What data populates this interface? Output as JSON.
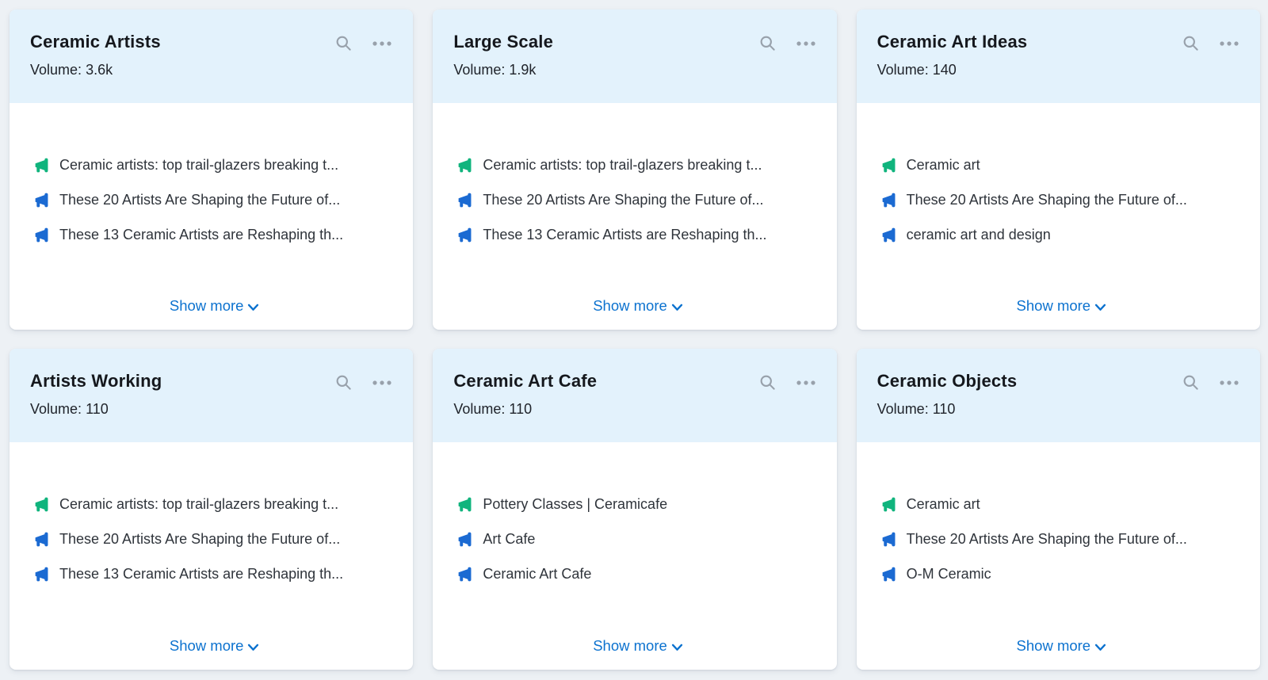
{
  "colors": {
    "page_background": "#edf1f5",
    "card_header_background": "#e3f2fc",
    "megaphone_green": "#10b47d",
    "megaphone_blue": "#1b6ad2",
    "link_blue": "#0c72cf",
    "header_icon_gray": "#98a1ab"
  },
  "card_common": {
    "volume_label": "Volume:",
    "show_more_label": "Show more"
  },
  "cards": [
    {
      "title": "Ceramic Artists",
      "volume_value": "3.6k",
      "items": [
        {
          "text": "Ceramic artists: top trail-glazers breaking t...",
          "icon_color": "green"
        },
        {
          "text": "These 20 Artists Are Shaping the Future of...",
          "icon_color": "blue"
        },
        {
          "text": "These 13 Ceramic Artists are Reshaping th...",
          "icon_color": "blue"
        }
      ]
    },
    {
      "title": "Large Scale",
      "volume_value": "1.9k",
      "items": [
        {
          "text": "Ceramic artists: top trail-glazers breaking t...",
          "icon_color": "green"
        },
        {
          "text": "These 20 Artists Are Shaping the Future of...",
          "icon_color": "blue"
        },
        {
          "text": "These 13 Ceramic Artists are Reshaping th...",
          "icon_color": "blue"
        }
      ]
    },
    {
      "title": "Ceramic Art Ideas",
      "volume_value": "140",
      "items": [
        {
          "text": "Ceramic art",
          "icon_color": "green"
        },
        {
          "text": "These 20 Artists Are Shaping the Future of...",
          "icon_color": "blue"
        },
        {
          "text": "ceramic art and design",
          "icon_color": "blue"
        }
      ]
    },
    {
      "title": "Artists Working",
      "volume_value": "110",
      "items": [
        {
          "text": "Ceramic artists: top trail-glazers breaking t...",
          "icon_color": "green"
        },
        {
          "text": "These 20 Artists Are Shaping the Future of...",
          "icon_color": "blue"
        },
        {
          "text": "These 13 Ceramic Artists are Reshaping th...",
          "icon_color": "blue"
        }
      ]
    },
    {
      "title": "Ceramic Art Cafe",
      "volume_value": "110",
      "items": [
        {
          "text": "Pottery Classes | Ceramicafe",
          "icon_color": "green"
        },
        {
          "text": "Art Cafe",
          "icon_color": "blue"
        },
        {
          "text": "Ceramic Art Cafe",
          "icon_color": "blue"
        }
      ]
    },
    {
      "title": "Ceramic Objects",
      "volume_value": "110",
      "items": [
        {
          "text": "Ceramic art",
          "icon_color": "green"
        },
        {
          "text": "These 20 Artists Are Shaping the Future of...",
          "icon_color": "blue"
        },
        {
          "text": "O-M Ceramic",
          "icon_color": "blue"
        }
      ]
    }
  ]
}
